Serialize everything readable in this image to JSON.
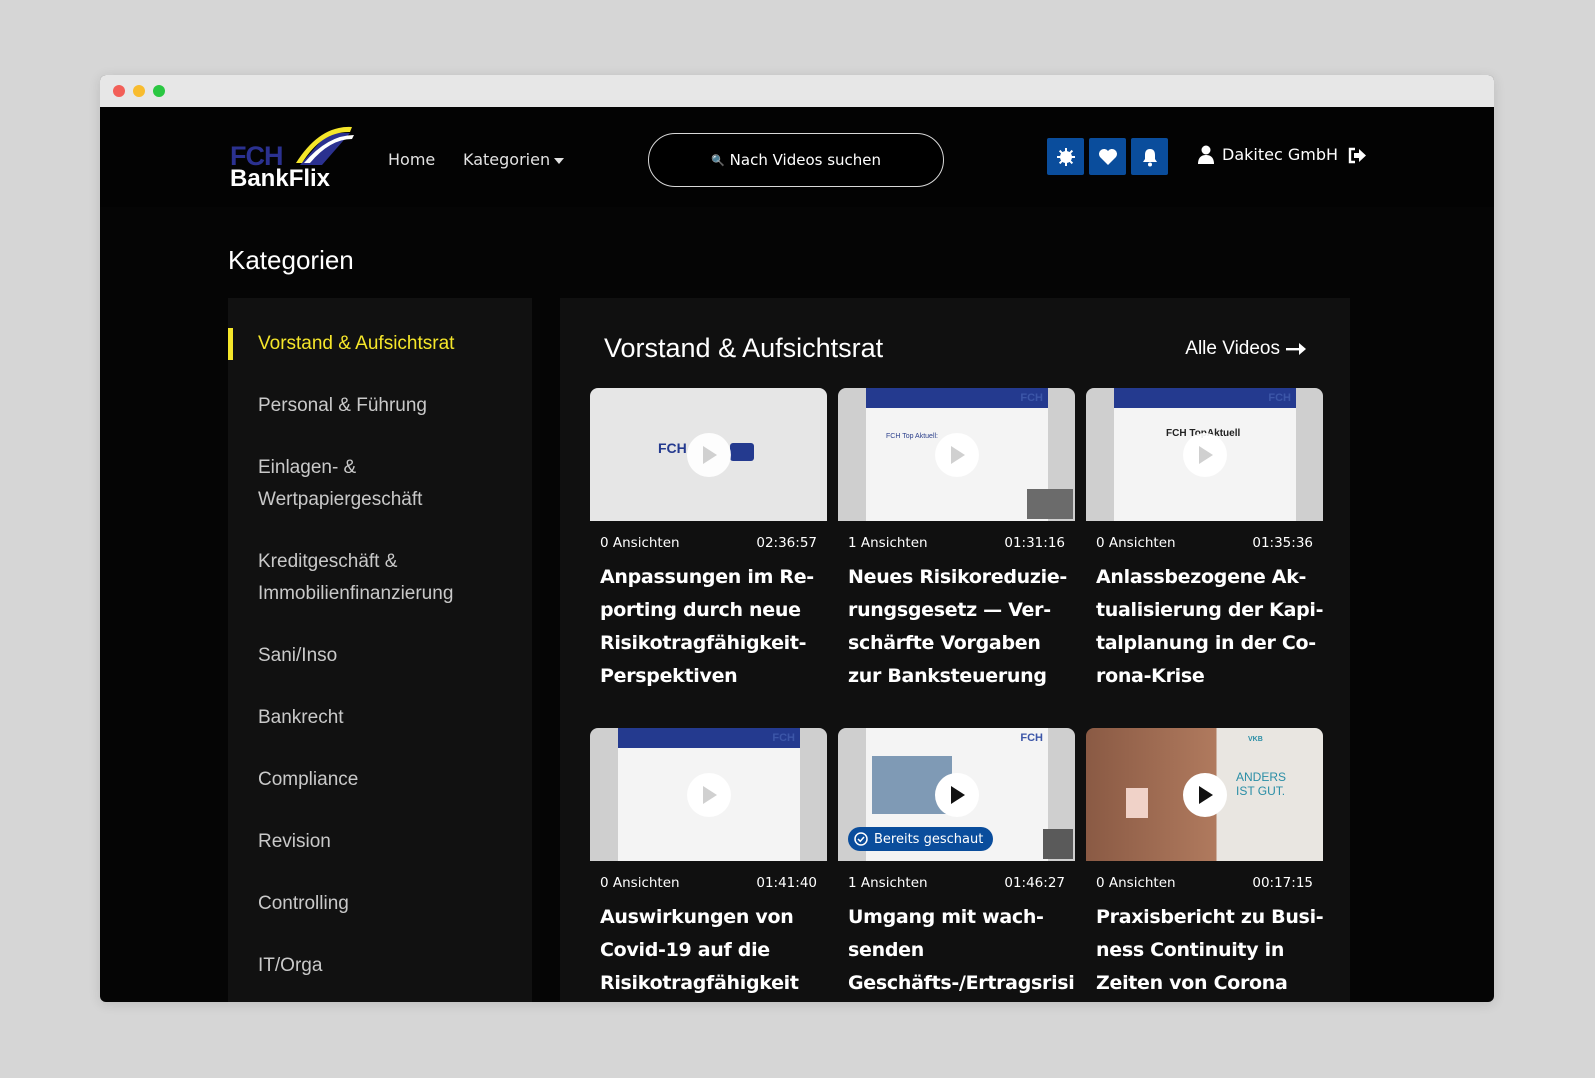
{
  "nav": {
    "logo_top": "FCH",
    "logo_bottom": "BankFlix",
    "home": "Home",
    "kategorien": "Kategorien",
    "search_label": "Nach Videos suchen",
    "user": "Dakitec GmbH"
  },
  "page_title": "Kategorien",
  "sidebar": {
    "items": [
      {
        "label": "Vorstand & Aufsichtsrat"
      },
      {
        "label": "Personal & Führung"
      },
      {
        "label": "Einlagen- & Wertpapiergeschäft"
      },
      {
        "label": "Kreditgeschäft & Immobilienfinanzierung"
      },
      {
        "label": "Sani/Inso"
      },
      {
        "label": "Bankrecht"
      },
      {
        "label": "Compliance"
      },
      {
        "label": "Revision"
      },
      {
        "label": "Controlling"
      },
      {
        "label": "IT/Orga"
      }
    ],
    "active_index": 0
  },
  "section": {
    "title": "Vorstand & Aufsichtsrat",
    "all_videos": "Alle Videos"
  },
  "videos": [
    {
      "views": "0 Ansichten",
      "duration": "02:36:57",
      "title_lines": [
        "Anpassungen im Re-",
        "porting durch neue",
        "Risikotragfähigkeit-",
        "Perspektiven"
      ],
      "thumb_text": "FCH"
    },
    {
      "views": "1 Ansichten",
      "duration": "01:31:16",
      "title_lines": [
        "Neues Risikoreduzie-",
        "rungsgesetz — Ver-",
        "schärfte Vorgaben",
        "zur Banksteuerung"
      ],
      "thumb_text": "FCH Top Aktuell:"
    },
    {
      "views": "0 Ansichten",
      "duration": "01:35:36",
      "title_lines": [
        "Anlassbezogene Ak-",
        "tualisierung der Kapi-",
        "talplanung in der Co-",
        "rona-Krise"
      ],
      "thumb_text": "FCH TopAktuell"
    },
    {
      "views": "0 Ansichten",
      "duration": "01:41:40",
      "title_lines": [
        "Auswirkungen von",
        "Covid-19 auf die",
        "Risikotragfähigkeit"
      ],
      "thumb_text": "FCH"
    },
    {
      "views": "1 Ansichten",
      "duration": "01:46:27",
      "title_lines": [
        "Umgang mit wach-",
        "senden",
        "Geschäfts-/Ertragsrisiken"
      ],
      "thumb_text": "FCH",
      "badge": "Bereits geschaut"
    },
    {
      "views": "0 Ansichten",
      "duration": "00:17:15",
      "title_lines": [
        "Praxisbericht zu Busi-",
        "ness Continuity in",
        "Zeiten von Corona"
      ],
      "thumb_text": "ANDERS IST GUT.",
      "thumb_corner": "VKB"
    }
  ],
  "colors": {
    "accent_yellow": "#f5e62a",
    "button_blue": "#0a4d9c",
    "background": "#050505"
  }
}
